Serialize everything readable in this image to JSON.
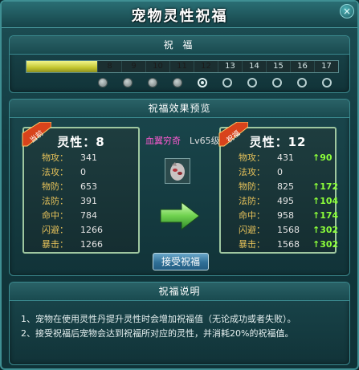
{
  "window": {
    "title": "宠物灵性祝福",
    "close_glyph": "×"
  },
  "blessing": {
    "header": "祝 福",
    "filled_segments": 7,
    "total_segments": 17,
    "segment_labels": [
      "",
      "",
      "",
      "",
      "",
      "",
      "",
      "8",
      "9",
      "10",
      "11",
      "12",
      "13",
      "14",
      "15",
      "16",
      "17"
    ],
    "dots": [
      "filled",
      "filled",
      "filled",
      "filled",
      "current",
      "empty",
      "empty",
      "empty",
      "empty",
      "empty"
    ]
  },
  "preview": {
    "header": "祝福效果预览",
    "pet_name": "血翼穷奇",
    "pet_level": "Lv65级",
    "current": {
      "ribbon": "当前",
      "title": "灵性：8",
      "stats": [
        {
          "label": "物攻：",
          "value": "341"
        },
        {
          "label": "法攻：",
          "value": "0"
        },
        {
          "label": "物防：",
          "value": "653"
        },
        {
          "label": "法防：",
          "value": "391"
        },
        {
          "label": "命中：",
          "value": "784"
        },
        {
          "label": "闪避：",
          "value": "1266"
        },
        {
          "label": "暴击：",
          "value": "1266"
        }
      ]
    },
    "next": {
      "ribbon": "祝福",
      "title": "灵性：12",
      "stats": [
        {
          "label": "物攻：",
          "value": "431",
          "up": "90"
        },
        {
          "label": "法攻：",
          "value": "0",
          "up": ""
        },
        {
          "label": "物防：",
          "value": "825",
          "up": "172"
        },
        {
          "label": "法防：",
          "value": "495",
          "up": "104"
        },
        {
          "label": "命中：",
          "value": "958",
          "up": "174"
        },
        {
          "label": "闪避：",
          "value": "1568",
          "up": "302"
        },
        {
          "label": "暴击：",
          "value": "1568",
          "up": "302"
        }
      ]
    },
    "up_arrow": "↑",
    "accept_button": "接受祝福"
  },
  "instructions": {
    "header": "祝福说明",
    "lines": [
      "1、宠物在使用灵性丹提升灵性时会增加祝福值（无论成功或者失败）。",
      "2、接受祝福后宠物会达到祝福所对应的灵性，并消耗20%的祝福值。"
    ]
  },
  "colors": {
    "accent": "#3f8f93",
    "stat_label": "#e6c25a",
    "increase": "#8cff3a",
    "pet_name": "#ff5ad2"
  }
}
